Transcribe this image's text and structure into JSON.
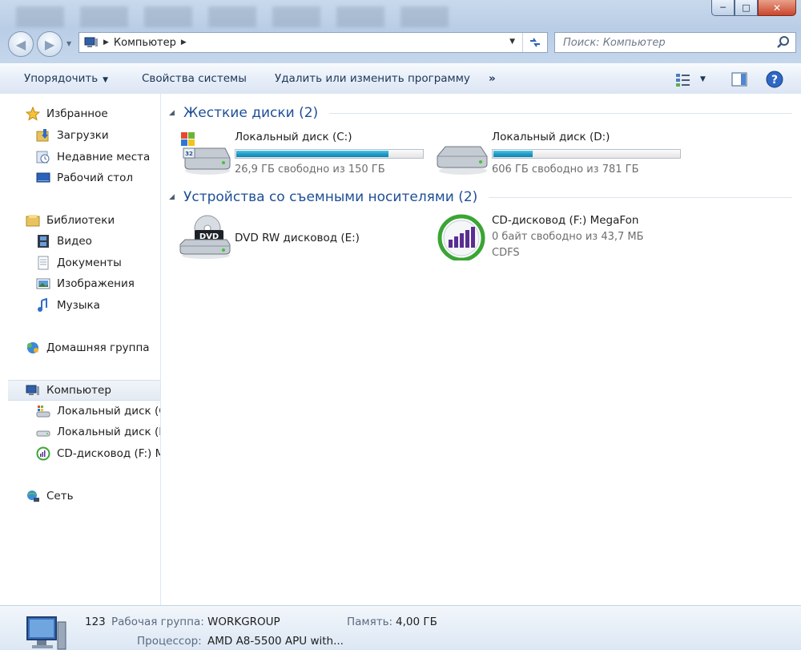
{
  "window": {
    "controls": {
      "minimize": "─",
      "maximize": "□",
      "close": "✕"
    }
  },
  "nav": {
    "back": "◀",
    "forward": "▶",
    "address": {
      "crumb": "Компьютер"
    },
    "search": {
      "placeholder": "Поиск: Компьютер"
    }
  },
  "toolbar": {
    "organize": "Упорядочить",
    "system_properties": "Свойства системы",
    "uninstall": "Удалить или изменить программу",
    "more": "»"
  },
  "sidebar": {
    "favorites": {
      "label": "Избранное",
      "items": [
        "Загрузки",
        "Недавние места",
        "Рабочий стол"
      ]
    },
    "libraries": {
      "label": "Библиотеки",
      "items": [
        "Видео",
        "Документы",
        "Изображения",
        "Музыка"
      ]
    },
    "homegroup": "Домашняя группа",
    "computer": {
      "label": "Компьютер",
      "items": [
        "Локальный диск (C:)",
        "Локальный диск (D:)",
        "CD-дисковод (F:) MegaFon"
      ]
    },
    "network": "Сеть"
  },
  "groups": {
    "hdd": {
      "title": "Жесткие диски (2)",
      "drives": [
        {
          "name": "Локальный диск (C:)",
          "info": "26,9 ГБ свободно из 150 ГБ",
          "used_fraction": 0.82
        },
        {
          "name": "Локальный диск (D:)",
          "info": "606 ГБ свободно из 781 ГБ",
          "used_fraction": 0.22
        }
      ]
    },
    "removable": {
      "title": "Устройства со съемными носителями (2)",
      "devices": [
        {
          "name": "DVD RW дисковод (E:)",
          "badge": "DVD"
        },
        {
          "name": "CD-дисковод (F:) MegaFon",
          "info": "0 байт свободно из 43,7 МБ",
          "fs": "CDFS"
        }
      ]
    }
  },
  "details": {
    "name": "123",
    "workgroup_label": "Рабочая группа:",
    "workgroup": "WORKGROUP",
    "memory_label": "Память:",
    "memory": "4,00 ГБ",
    "cpu_label": "Процессор:",
    "cpu": "AMD A8-5500 APU with..."
  },
  "colors": {
    "accent_title": "#1e4f96",
    "bar_fill": "#1e9bc4",
    "megafon_green": "#3aa535",
    "megafon_purple": "#5a2d91"
  }
}
